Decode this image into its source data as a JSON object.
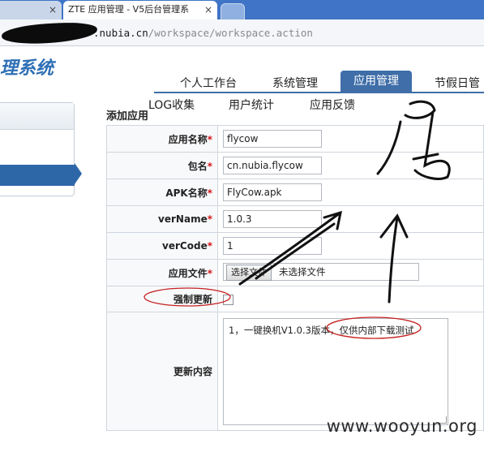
{
  "browser": {
    "tabs": [
      {
        "label": "",
        "close": "×"
      },
      {
        "label": "ZTE 应用管理 - V5后台管理系",
        "close": "×"
      },
      {
        "label": ""
      }
    ],
    "url_host": ".nubia.cn",
    "url_path": "/workspace/workspace.action"
  },
  "app": {
    "title": "理系统",
    "nav": [
      "个人工作台",
      "系统管理",
      "应用管理",
      "节假日管"
    ],
    "active_nav": "应用管理",
    "subnav": [
      "LOG收集",
      "用户统计",
      "应用反馈"
    ]
  },
  "form": {
    "title": "添加应用",
    "required_mark": "*",
    "fields": [
      {
        "label": "应用名称",
        "required": true,
        "value": "flycow"
      },
      {
        "label": "包名",
        "required": true,
        "value": "cn.nubia.flycow"
      },
      {
        "label": "APK名称",
        "required": true,
        "value": "FlyCow.apk"
      },
      {
        "label": "verName",
        "required": true,
        "value": "1.0.3"
      },
      {
        "label": "verCode",
        "required": true,
        "value": "1"
      }
    ],
    "file_label": "应用文件",
    "file_button": "选择文件",
    "file_status": "未选择文件",
    "force_update_label": "强制更新",
    "content_label": "更新内容",
    "content_value": "1，一键换机V1.0.3版本，仅供内部下载测试"
  },
  "watermark": "www.wooyun.org",
  "colors": {
    "tabstrip": "#3f74c7",
    "nav_active": "#3f6ea8",
    "required": "#d01818",
    "annotation_red": "#c62020"
  }
}
